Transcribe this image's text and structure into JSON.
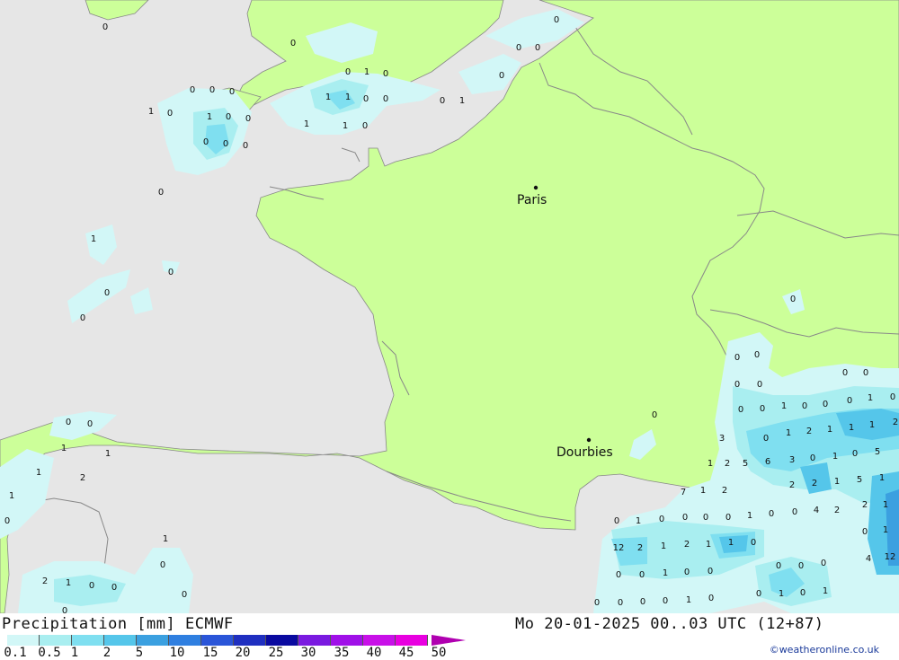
{
  "map": {
    "colors": {
      "sea": "#e6e6e6",
      "land": "#ccff99",
      "border": "#888888",
      "p1": "#d2f7f7",
      "p2": "#a9eef0",
      "p3": "#7fdff0",
      "p4": "#55c6ea",
      "p5": "#3ba0e0"
    },
    "cities": [
      {
        "name": "Paris"
      },
      {
        "name": "Dourbies"
      }
    ],
    "values": [
      "0",
      "0",
      "0",
      "0",
      "0",
      "0",
      "0",
      "1",
      "0",
      "0",
      "0",
      "0",
      "1",
      "1",
      "0",
      "0",
      "0",
      "1",
      "1",
      "0",
      "1",
      "0",
      "0",
      "1",
      "1",
      "0",
      "0",
      "0",
      "0",
      "0",
      "1",
      "0",
      "0",
      "0",
      "0",
      "0",
      "0",
      "0",
      "0",
      "0",
      "0",
      "0",
      "0",
      "1",
      "0",
      "0",
      "0",
      "1",
      "0",
      "0",
      "0",
      "0",
      "0",
      "1",
      "2",
      "1",
      "1",
      "1",
      "2",
      "1",
      "1",
      "3",
      "1",
      "2",
      "5",
      "6",
      "3",
      "0",
      "1",
      "0",
      "5",
      "1",
      "2",
      "2",
      "2",
      "1",
      "5",
      "1",
      "7",
      "1",
      "2",
      "1",
      "2",
      "1",
      "0",
      "0",
      "1",
      "0",
      "0",
      "0",
      "0",
      "1",
      "0",
      "0",
      "4",
      "2",
      "0",
      "1",
      "1",
      "12",
      "2",
      "1",
      "2",
      "1",
      "1",
      "0",
      "4",
      "12",
      "0",
      "0",
      "0",
      "0",
      "0",
      "0",
      "1",
      "0",
      "0",
      "2",
      "1",
      "0",
      "0",
      "0",
      "1",
      "0",
      "1",
      "0",
      "0",
      "0",
      "0",
      "0",
      "1",
      "0",
      "0"
    ]
  },
  "footer": {
    "title": "Precipitation [mm] ECMWF",
    "datetime": "Mo 20-01-2025 00..03 UTC (12+87)",
    "credit": "©weatheronline.co.uk",
    "legend": {
      "labels": [
        "0.1",
        "0.5",
        "1",
        "2",
        "5",
        "10",
        "15",
        "20",
        "25",
        "30",
        "35",
        "40",
        "45",
        "50"
      ],
      "colors": [
        "#d2f7f7",
        "#a9eef0",
        "#7fdff0",
        "#55c6ea",
        "#3ba0e0",
        "#2f7fe0",
        "#2a55d8",
        "#1f2fc0",
        "#0a0aa0",
        "#7a1ae0",
        "#a010e8",
        "#c810e8",
        "#e800e0",
        "#b000b0"
      ]
    }
  }
}
